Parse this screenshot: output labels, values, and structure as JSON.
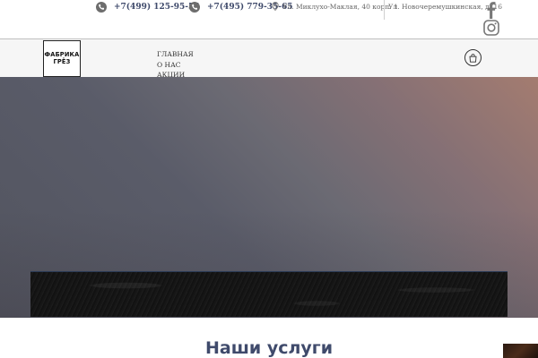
{
  "contacts": {
    "phone1": "+7(499) 125-95-55",
    "phone2": "+7(495) 779-35-65",
    "address1": "Ул. Миклухо-Маклая, 40 корп. 1",
    "address2": "Ул. Новочеремушкинская, д. 16"
  },
  "logo": {
    "line1": "ФАБРИКА",
    "line2": "ГРЁЗ"
  },
  "nav": {
    "items": [
      "ГЛАВНАЯ",
      "О НАС",
      "АКЦИИ"
    ]
  },
  "section": {
    "title": "Наши услуги"
  },
  "icons": {
    "phone": "phone-icon",
    "pin": "map-pin-icon",
    "facebook": "facebook-icon",
    "instagram": "instagram-icon",
    "cart": "shopping-bag-icon"
  },
  "colors": {
    "accent": "#3f4a6b",
    "hero_start": "#a47c70",
    "hero_end": "#52545f"
  }
}
